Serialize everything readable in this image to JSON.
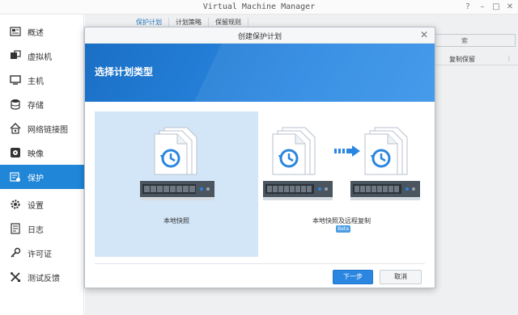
{
  "app": {
    "title": "Virtual Machine Manager",
    "accent_color": "#1f86d8"
  },
  "window_controls": [
    {
      "name": "help-icon",
      "glyph": "?"
    },
    {
      "name": "minimize-icon",
      "glyph": "–"
    },
    {
      "name": "maximize-icon",
      "glyph": "□"
    },
    {
      "name": "close-icon",
      "glyph": "✕"
    }
  ],
  "sidebar": {
    "items": [
      {
        "label": "概述",
        "icon": "overview-icon",
        "active": false
      },
      {
        "label": "虚拟机",
        "icon": "virtual-machine-icon",
        "active": false
      },
      {
        "label": "主机",
        "icon": "host-icon",
        "active": false
      },
      {
        "label": "存储",
        "icon": "storage-icon",
        "active": false
      },
      {
        "label": "网络链接图",
        "icon": "network-icon",
        "active": false
      },
      {
        "label": "映像",
        "icon": "image-icon",
        "active": false
      },
      {
        "label": "保护",
        "icon": "protection-icon",
        "active": true
      },
      {
        "label": "设置",
        "icon": "gear-icon",
        "active": false
      },
      {
        "label": "日志",
        "icon": "log-icon",
        "active": false
      },
      {
        "label": "许可证",
        "icon": "license-key-icon",
        "active": false
      },
      {
        "label": "测试反馈",
        "icon": "test-feedback-icon",
        "active": false
      }
    ]
  },
  "main": {
    "tabs": [
      "保护计划",
      "计划策略",
      "保留规则"
    ],
    "search_fragment": "索",
    "column_header": "复制保留"
  },
  "dialog": {
    "title": "创建保护计划",
    "banner_title": "选择计划类型",
    "options": [
      {
        "label": "本地快照",
        "selected": true
      },
      {
        "label": "本地快照及远程复制",
        "badge": "Beta",
        "selected": false
      }
    ],
    "buttons": {
      "next": "下一步",
      "cancel": "取消"
    }
  }
}
